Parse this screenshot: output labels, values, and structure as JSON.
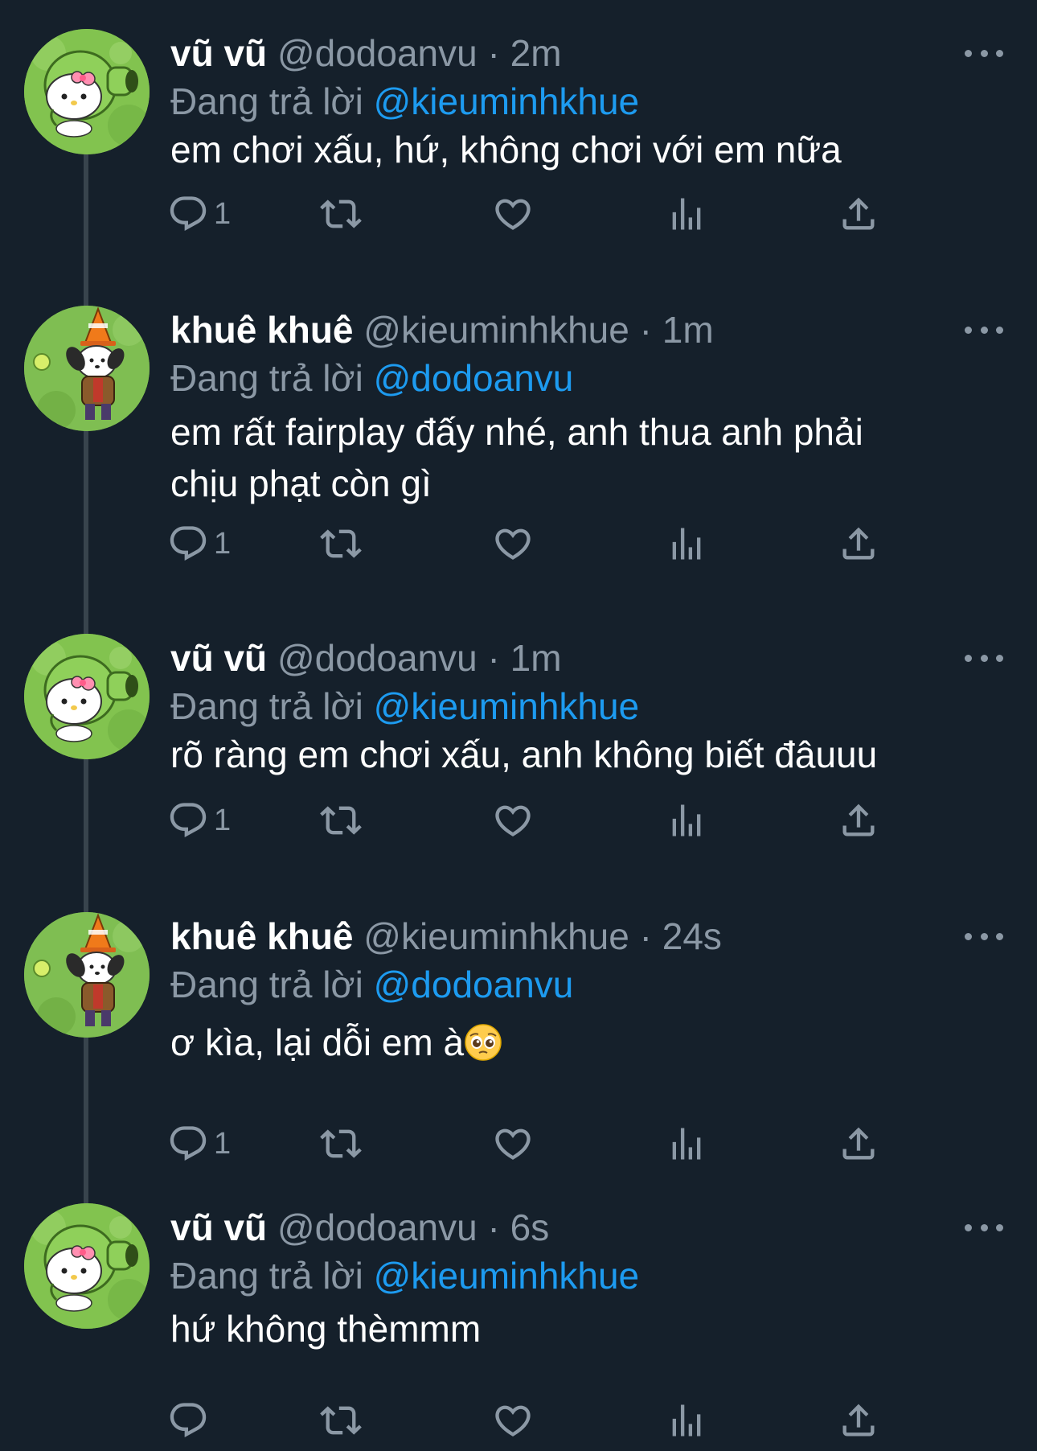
{
  "labels": {
    "replying_to": "Đang trả lời",
    "separator": "·"
  },
  "tweets": [
    {
      "author": "vũ vũ",
      "handle": "@dodoanvu",
      "time": "2m",
      "reply_to": "@kieuminhkhue",
      "text": "em chơi xấu, hứ, không chơi với em nữa",
      "reply_count": "1",
      "avatar_icon": "hello-kitty-peashooter-avatar"
    },
    {
      "author": "khuê khuê",
      "handle": "@kieuminhkhue",
      "time": "1m",
      "reply_to": "@dodoanvu",
      "text_lines": [
        "em rất fairplay đấy nhé, anh thua anh phải",
        "chịu phạt còn gì"
      ],
      "reply_count": "1",
      "avatar_icon": "pochacco-conehead-avatar"
    },
    {
      "author": "vũ vũ",
      "handle": "@dodoanvu",
      "time": "1m",
      "reply_to": "@kieuminhkhue",
      "text": "rõ ràng em chơi xấu, anh không biết đâuuu",
      "reply_count": "1",
      "avatar_icon": "hello-kitty-peashooter-avatar"
    },
    {
      "author": "khuê khuê",
      "handle": "@kieuminhkhue",
      "time": "24s",
      "reply_to": "@dodoanvu",
      "text": "ơ kìa, lại dỗi em à",
      "emoji": "pleading-face-emoji",
      "reply_count": "1",
      "avatar_icon": "pochacco-conehead-avatar"
    },
    {
      "author": "vũ vũ",
      "handle": "@dodoanvu",
      "time": "6s",
      "reply_to": "@kieuminhkhue",
      "text": "hứ không thèmmm",
      "reply_count": "",
      "avatar_icon": "hello-kitty-peashooter-avatar"
    }
  ],
  "action_icons": [
    "reply-icon",
    "retweet-icon",
    "like-icon",
    "views-icon",
    "share-icon"
  ],
  "colors": {
    "background": "#15202b",
    "text": "#ffffff",
    "secondary": "#8b98a5",
    "accent": "#1d9bf0",
    "thread_line": "#38444d"
  }
}
